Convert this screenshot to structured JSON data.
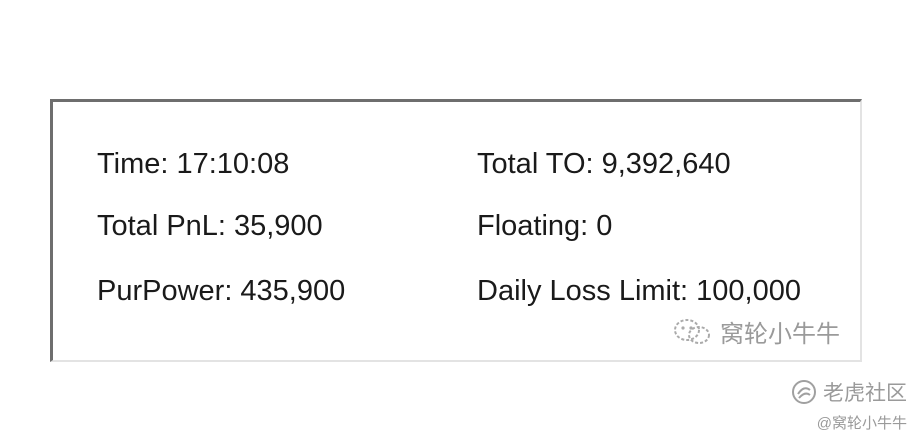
{
  "stats": {
    "time": {
      "label": "Time:",
      "value": "17:10:08"
    },
    "total_to": {
      "label": "Total TO:",
      "value": "9,392,640"
    },
    "total_pnl": {
      "label": "Total PnL:",
      "value": "35,900"
    },
    "floating": {
      "label": "Floating:",
      "value": "0"
    },
    "pur_power": {
      "label": "PurPower:",
      "value": "435,900"
    },
    "daily_loss_limit": {
      "label": "Daily Loss Limit:",
      "value": "100,000"
    }
  },
  "watermarks": {
    "inner": {
      "icon": "wechat-icon",
      "text": "窝轮小牛牛"
    },
    "outer": {
      "icon": "tiger-community-logo-icon",
      "text": "老虎社区"
    },
    "handle": "@窝轮小牛牛"
  }
}
